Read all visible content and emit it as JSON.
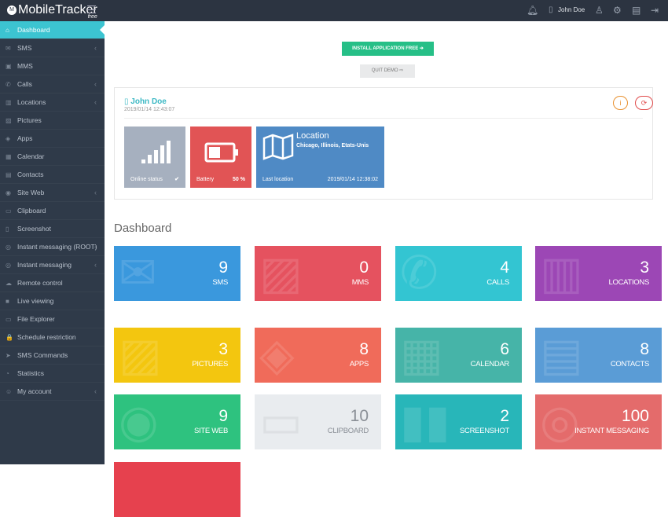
{
  "topbar": {
    "brand": "MobileTracker",
    "brand_sub": "free",
    "logo_letter": "M",
    "user": "John Doe",
    "icons": [
      "bell-icon",
      "phone-icon",
      "user-icon",
      "settings-icon",
      "basket-icon",
      "logout-icon"
    ]
  },
  "sidebar": {
    "items": [
      {
        "label": "Dashboard",
        "icon": "⌂",
        "active": true,
        "chev": false
      },
      {
        "label": "SMS",
        "icon": "✉",
        "chev": true
      },
      {
        "label": "MMS",
        "icon": "▣",
        "chev": false
      },
      {
        "label": "Calls",
        "icon": "✆",
        "chev": true
      },
      {
        "label": "Locations",
        "icon": "▥",
        "chev": true
      },
      {
        "label": "Pictures",
        "icon": "▨",
        "chev": false
      },
      {
        "label": "Apps",
        "icon": "◈",
        "chev": false
      },
      {
        "label": "Calendar",
        "icon": "▦",
        "chev": false
      },
      {
        "label": "Contacts",
        "icon": "▤",
        "chev": false
      },
      {
        "label": "Site Web",
        "icon": "◉",
        "chev": true
      },
      {
        "label": "Clipboard",
        "icon": "▭",
        "chev": false
      },
      {
        "label": "Screenshot",
        "icon": "▯",
        "chev": false
      },
      {
        "label": "Instant messaging (ROOT)",
        "icon": "◎",
        "chev": true
      },
      {
        "label": "Instant messaging",
        "icon": "◎",
        "chev": true
      },
      {
        "label": "Remote control",
        "icon": "☁",
        "chev": false
      },
      {
        "label": "Live viewing",
        "icon": "■",
        "chev": false
      },
      {
        "label": "File Explorer",
        "icon": "▭",
        "chev": false
      },
      {
        "label": "Schedule restriction",
        "icon": "🔒",
        "chev": false
      },
      {
        "label": "SMS Commands",
        "icon": "➤",
        "chev": false
      },
      {
        "label": "Statistics",
        "icon": "◔",
        "chev": false
      },
      {
        "label": "My account",
        "icon": "☺",
        "chev": true
      }
    ]
  },
  "actions": {
    "install": "INSTALL APPLICATION FREE ➔",
    "quit": "QUIT DEMO ⇨"
  },
  "device": {
    "name": "John Doe",
    "date": "2019/01/14 12:43:07",
    "online": {
      "label": "Online status",
      "value": "✔"
    },
    "battery": {
      "label": "Battery",
      "value": "50 %",
      "level": 50
    },
    "location": {
      "title": "Location",
      "place": "Chicago, Illinois, Etats-Unis",
      "label": "Last location",
      "date": "2019/01/14 12:38:02"
    }
  },
  "dashboard": {
    "title": "Dashboard",
    "tiles": [
      {
        "num": "9",
        "label": "SMS",
        "color": "#3a98dd",
        "icon": "✉"
      },
      {
        "num": "0",
        "label": "MMS",
        "color": "#e5525f",
        "icon": "▨"
      },
      {
        "num": "4",
        "label": "CALLS",
        "color": "#33c5d2",
        "icon": "✆"
      },
      {
        "num": "3",
        "label": "LOCATIONS",
        "color": "#9c47b5",
        "icon": "▥"
      },
      {
        "num": "3",
        "label": "PICTURES",
        "color": "#f3c60f",
        "icon": "▨"
      },
      {
        "num": "8",
        "label": "APPS",
        "color": "#f06b5a",
        "icon": "◈"
      },
      {
        "num": "6",
        "label": "CALENDAR",
        "color": "#46b4a8",
        "icon": "▦"
      },
      {
        "num": "8",
        "label": "CONTACTS",
        "color": "#5a9cd6",
        "icon": "▤"
      },
      {
        "num": "9",
        "label": "SITE WEB",
        "color": "#2ec27f",
        "icon": "◉"
      },
      {
        "num": "10",
        "label": "CLIPBOARD",
        "color": "#e9ecef",
        "icon": "▭",
        "dark": true
      },
      {
        "num": "2",
        "label": "SCREENSHOT",
        "color": "#28b6b9",
        "icon": "▮▮"
      },
      {
        "num": "100",
        "label": "INSTANT MESSAGING",
        "color": "#e46b6b",
        "icon": "◎"
      },
      {
        "num": "",
        "label": "",
        "color": "#e6414e",
        "icon": ""
      }
    ]
  }
}
